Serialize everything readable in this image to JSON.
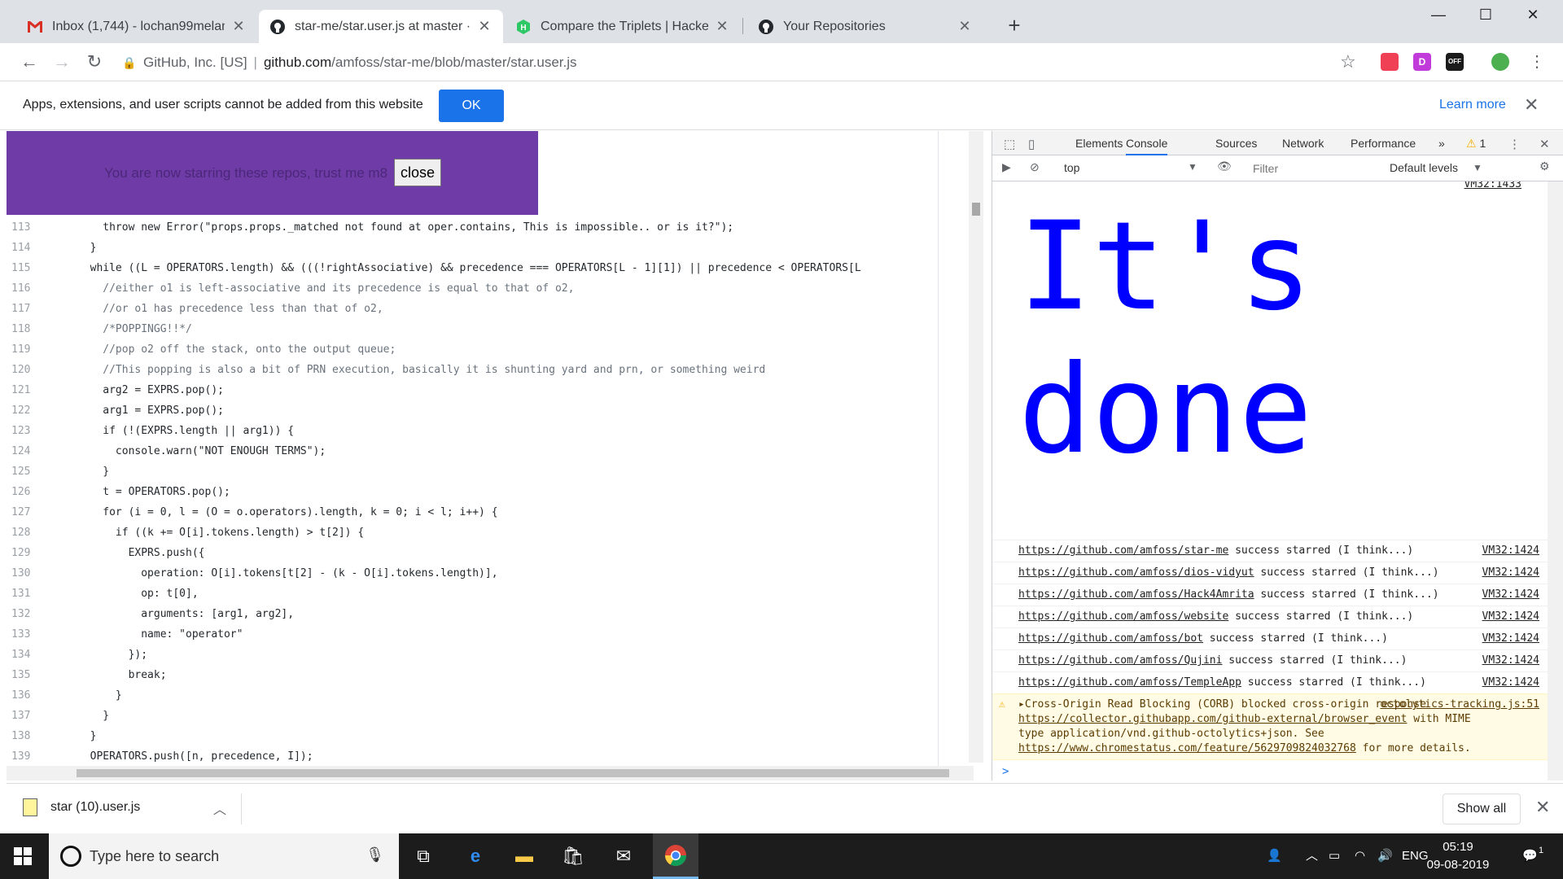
{
  "tabs": [
    {
      "title": "Inbox (1,744) - lochan99melam@",
      "icon": "gmail-icon"
    },
    {
      "title": "star-me/star.user.js at master · am",
      "icon": "github-icon"
    },
    {
      "title": "Compare the Triplets | HackerRan",
      "icon": "hackerrank-icon"
    },
    {
      "title": "Your Repositories",
      "icon": "github-icon"
    }
  ],
  "address": {
    "site": "GitHub, Inc. [US]",
    "host": "github.com",
    "path": "/amfoss/star-me/blob/master/star.user.js"
  },
  "extensions": [
    {
      "icon": "pocket-icon",
      "label": "",
      "color": "#ef4056"
    },
    {
      "icon": "d-extension-icon",
      "label": "D",
      "color": "#c13bdb"
    },
    {
      "icon": "honey-icon",
      "label": "OFF",
      "color": "#1b1b1b"
    },
    {
      "icon": "profile-avatar-icon",
      "label": "",
      "color": "#4caf50"
    }
  ],
  "infobar": {
    "message": "Apps, extensions, and user scripts cannot be added from this website",
    "ok": "OK",
    "learn_more": "Learn more"
  },
  "banner": {
    "message": "You are now starring these repos, trust me m8",
    "close": "close",
    "color": "#6f3ca7"
  },
  "code": [
    {
      "n": "113",
      "text": "          throw new Error(\"props.props._matched not found at oper.contains, This is impossible.. or is it?\");"
    },
    {
      "n": "114",
      "text": "        }"
    },
    {
      "n": "115",
      "text": "        while ((L = OPERATORS.length) && (((!rightAssociative) && precedence === OPERATORS[L - 1][1]) || precedence < OPERATORS[L"
    },
    {
      "n": "116",
      "text": "          //either o1 is left-associative and its precedence is equal to that of o2,"
    },
    {
      "n": "117",
      "text": "          //or o1 has precedence less than that of o2,"
    },
    {
      "n": "118",
      "text": "          /*POPPINGG!!*/"
    },
    {
      "n": "119",
      "text": "          //pop o2 off the stack, onto the output queue;"
    },
    {
      "n": "120",
      "text": "          //This popping is also a bit of PRN execution, basically it is shunting yard and prn, or something weird"
    },
    {
      "n": "121",
      "text": "          arg2 = EXPRS.pop();"
    },
    {
      "n": "122",
      "text": "          arg1 = EXPRS.pop();"
    },
    {
      "n": "123",
      "text": "          if (!(EXPRS.length || arg1)) {"
    },
    {
      "n": "124",
      "text": "            console.warn(\"NOT ENOUGH TERMS\");"
    },
    {
      "n": "125",
      "text": "          }"
    },
    {
      "n": "126",
      "text": "          t = OPERATORS.pop();"
    },
    {
      "n": "127",
      "text": "          for (i = 0, l = (O = o.operators).length, k = 0; i < l; i++) {"
    },
    {
      "n": "128",
      "text": "            if ((k += O[i].tokens.length) > t[2]) {"
    },
    {
      "n": "129",
      "text": "              EXPRS.push({"
    },
    {
      "n": "130",
      "text": "                operation: O[i].tokens[t[2] - (k - O[i].tokens.length)],"
    },
    {
      "n": "131",
      "text": "                op: t[0],"
    },
    {
      "n": "132",
      "text": "                arguments: [arg1, arg2],"
    },
    {
      "n": "133",
      "text": "                name: \"operator\""
    },
    {
      "n": "134",
      "text": "              });"
    },
    {
      "n": "135",
      "text": "              break;"
    },
    {
      "n": "136",
      "text": "            }"
    },
    {
      "n": "137",
      "text": "          }"
    },
    {
      "n": "138",
      "text": "        }"
    },
    {
      "n": "139",
      "text": "        OPERATORS.push([n, precedence, I]);"
    }
  ],
  "devtools": {
    "tabs": [
      "Elements",
      "Console",
      "Sources",
      "Network",
      "Performance"
    ],
    "active_tab": "Console",
    "more": "»",
    "warn_count": "1",
    "context": "top",
    "filter_placeholder": "Filter",
    "levels": "Default levels",
    "top_source": "VM32:1433",
    "big_text": [
      "It's",
      "done"
    ],
    "big_color": "#0000ff",
    "messages": [
      {
        "url": "https://github.com/amfoss/star-me",
        "text": " success starred (I think...)",
        "source": "VM32:1424"
      },
      {
        "url": "https://github.com/amfoss/dios-vidyut",
        "text": " success starred (I think...)",
        "source": "VM32:1424"
      },
      {
        "url": "https://github.com/amfoss/Hack4Amrita",
        "text": " success starred (I think...)",
        "source": "VM32:1424"
      },
      {
        "url": "https://github.com/amfoss/website",
        "text": " success starred (I think...)",
        "source": "VM32:1424"
      },
      {
        "url": "https://github.com/amfoss/bot",
        "text": " success starred (I think...)",
        "source": "VM32:1424"
      },
      {
        "url": "https://github.com/amfoss/Qujini",
        "text": " success starred (I think...)",
        "source": "VM32:1424"
      },
      {
        "url": "https://github.com/amfoss/TempleApp",
        "text": " success starred (I think...)",
        "source": "VM32:1424"
      }
    ],
    "warning": {
      "lead": "Cross-Origin Read Blocking (CORB) blocked cross-origin response ",
      "url1": "https://collector.githubapp.com/github-external/browser_event",
      "mid": " with MIME type application/vnd.github-octolytics+json. See ",
      "url2": "https://www.chromestatus.com/feature/5629709824032768",
      "tail": " for more details.",
      "source": "octolytics-tracking.js:51"
    },
    "prompt": ">"
  },
  "download": {
    "file": "star (10).user.js",
    "show_all": "Show all"
  },
  "taskbar": {
    "search_placeholder": "Type here to search",
    "lang": "ENG",
    "time": "05:19",
    "date": "09-08-2019",
    "notifications": "1"
  }
}
